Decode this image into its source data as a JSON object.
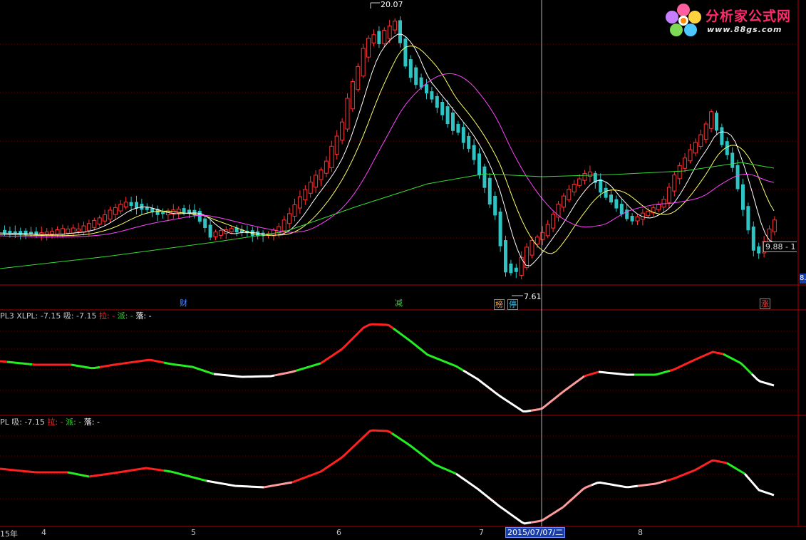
{
  "app": {
    "logo": {
      "name": "分析家公式网",
      "url": "www.88gs.com"
    }
  },
  "price_panel": {
    "high_label": "20.07",
    "low_label": "7.61",
    "last_price": "9.88 - 1",
    "right_edge_tag": "8."
  },
  "event_markers": [
    {
      "text": "财",
      "color": "#4f8cff"
    },
    {
      "text": "减",
      "color": "#33dd33"
    },
    {
      "text": "榜",
      "color": "#ff9933"
    },
    {
      "text": "停",
      "color": "#33ccff"
    },
    {
      "text": "涨",
      "color": "#ff4444"
    }
  ],
  "indicator1": {
    "header": [
      {
        "text": "PL3 XLPL: -7.15",
        "color": "#cfcfcf"
      },
      {
        "text": "吸: -7.15",
        "color": "#cfcfcf"
      },
      {
        "text": "拉: -",
        "color": "#ff3333"
      },
      {
        "text": "派: -",
        "color": "#33dd33"
      },
      {
        "text": "落: -",
        "color": "#ffffff"
      }
    ]
  },
  "indicator2": {
    "header": [
      {
        "text": "PL 吸: -7.15",
        "color": "#cfcfcf"
      },
      {
        "text": "拉: -",
        "color": "#ff3333"
      },
      {
        "text": "派: -",
        "color": "#33dd33"
      },
      {
        "text": "落: -",
        "color": "#ffffff"
      }
    ]
  },
  "time_axis": {
    "labels": [
      "15年",
      "4",
      "5",
      "6",
      "7",
      "8"
    ],
    "cursor_date": "2015/07/07/二"
  },
  "colors": {
    "up": "#ff3333",
    "down": "#2ec4c4",
    "ma5": "#ffffff",
    "ma10": "#ffff66",
    "ma20": "#ff44ff",
    "ma60": "#33dd33",
    "grid": "#7a0000",
    "lift": "#ff2020",
    "distribute": "#22ee22",
    "fall": "#ffffff",
    "absorb": "#ff9a9a"
  }
}
